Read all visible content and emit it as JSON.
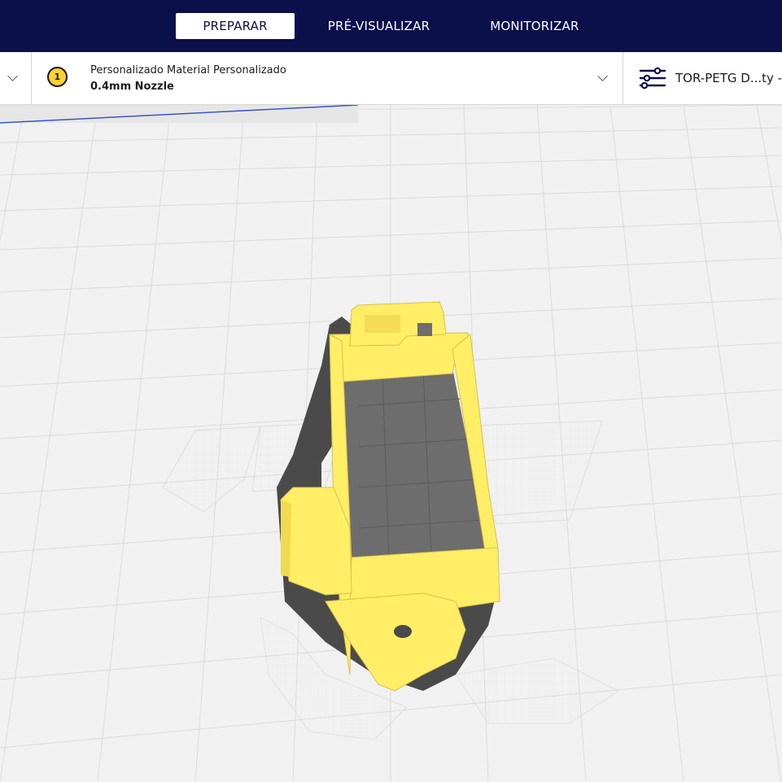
{
  "tabs": [
    {
      "label": "PREPARAR",
      "active": true
    },
    {
      "label": "PRÉ-VISUALIZAR",
      "active": false
    },
    {
      "label": "MONITORIZAR",
      "active": false
    }
  ],
  "extruder": {
    "number": "1",
    "material": "Personalizado Material Personalizado",
    "nozzle": "0.4mm Nozzle"
  },
  "print_profile": {
    "name": "TOR-PETG D...ty -"
  },
  "colors": {
    "header_bg": "#0b0f4a",
    "model_yellow": "#ffee66",
    "model_shadow": "#4a4a4a",
    "plate_bg": "#f1f1f1"
  },
  "icons": {
    "printer_dropdown": "chevron-down-icon",
    "extruder": "extruder-number-icon",
    "extruder_dropdown": "chevron-down-icon",
    "print_settings": "sliders-icon"
  }
}
